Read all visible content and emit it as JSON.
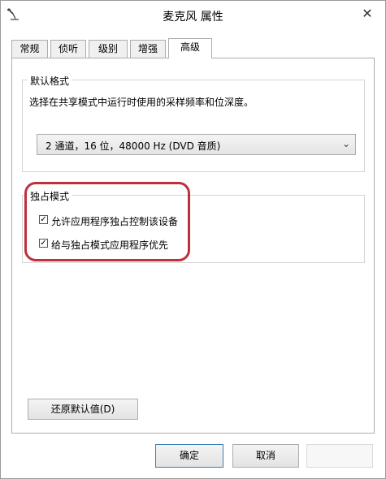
{
  "window": {
    "title": "麦克风 属性",
    "close_glyph": "✕",
    "icon": "microphone-icon"
  },
  "tabs": [
    {
      "label": "常规"
    },
    {
      "label": "侦听"
    },
    {
      "label": "级别"
    },
    {
      "label": "增强"
    },
    {
      "label": "高级",
      "active": true
    }
  ],
  "default_format": {
    "legend": "默认格式",
    "description": "选择在共享模式中运行时使用的采样频率和位深度。",
    "selected_value": "2 通道，16 位，48000 Hz (DVD 音质)",
    "arrow": "⌄"
  },
  "exclusive_mode": {
    "legend": "独占模式",
    "options": [
      {
        "label": "允许应用程序独占控制该设备",
        "checked": true
      },
      {
        "label": "给与独占模式应用程序优先",
        "checked": true
      }
    ],
    "check_glyph": "✓"
  },
  "buttons": {
    "restore_defaults": "还原默认值(D)",
    "ok": "确定",
    "cancel": "取消"
  },
  "colors": {
    "highlight": "#c0303c"
  }
}
